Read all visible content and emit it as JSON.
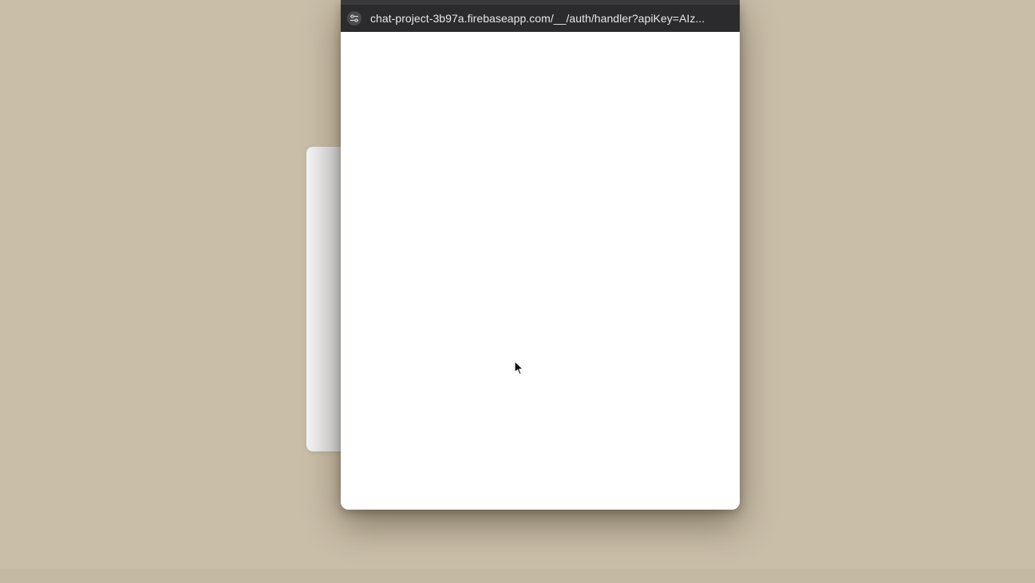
{
  "popup": {
    "url": "chat-project-3b97a.firebaseapp.com/__/auth/handler?apiKey=AIz...",
    "site_info_icon": "tune-icon"
  },
  "cursor": {
    "icon": "arrow-cursor-icon"
  },
  "colors": {
    "desktop_background": "#c9bea8",
    "url_bar_background": "#2b2b2d",
    "url_text": "#e8e8ea",
    "page_background": "#ffffff"
  }
}
